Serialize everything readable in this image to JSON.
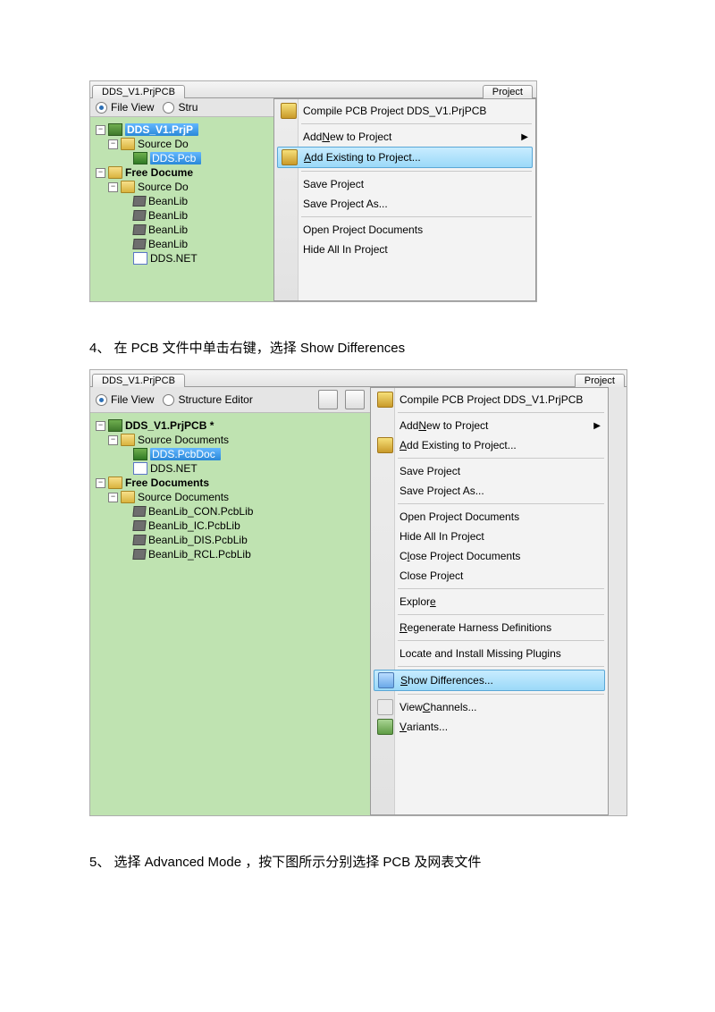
{
  "step4": "4、   在 PCB 文件中单击右键，选择 Show Differences",
  "step5": "5、   选择 Advanced Mode ，按下图所示分别选择 PCB 及网表文件",
  "shot1": {
    "tab_left": "DDS_V1.PrjPCB",
    "tab_right": "Project",
    "view_file": "File View",
    "view_struct": "Stru",
    "tree": {
      "proj": "DDS_V1.PrjP",
      "src1": "Source Do",
      "pcb": "DDS.Pcb",
      "free": "Free Docume",
      "src2": "Source Do",
      "libs": [
        "BeanLib",
        "BeanLib",
        "BeanLib",
        "BeanLib"
      ],
      "net": "DDS.NET"
    },
    "menu": {
      "compile": "Compile PCB Project DDS_V1.PrjPCB",
      "addnew_pre": "Add ",
      "addnew_u": "N",
      "addnew_post": "ew to Project",
      "addexist_u": "A",
      "addexist_post": "dd Existing to Project...",
      "save": "Save Project",
      "saveas": "Save Project As...",
      "open": "Open Project Documents",
      "hide": "Hide All In Project"
    }
  },
  "shot2": {
    "tab_left": "DDS_V1.PrjPCB",
    "tab_right": "Project",
    "view_file": "File View",
    "view_struct": "Structure Editor",
    "tree": {
      "proj": "DDS_V1.PrjPCB *",
      "src1": "Source Documents",
      "pcb": "DDS.PcbDoc",
      "net": "DDS.NET",
      "free": "Free Documents",
      "src2": "Source Documents",
      "libs": [
        "BeanLib_CON.PcbLib",
        "BeanLib_IC.PcbLib",
        "BeanLib_DIS.PcbLib",
        "BeanLib_RCL.PcbLib"
      ]
    },
    "menu": {
      "compile": "Compile PCB Project DDS_V1.PrjPCB",
      "addnew_pre": "Add ",
      "addnew_u": "N",
      "addnew_post": "ew to Project",
      "addexist_u": "A",
      "addexist_post": "dd Existing to Project...",
      "save": "Save Project",
      "saveas": "Save Project As...",
      "open": "Open Project Documents",
      "hide": "Hide All In Project",
      "close_pre": "C",
      "close_u": "l",
      "close_post": "ose Project Documents",
      "closeproj": "Close Project",
      "explore_pre": "Explor",
      "explore_u": "e",
      "regen_u": "R",
      "regen_post": "egenerate Harness Definitions",
      "locate": "Locate and Install Missing Plugins",
      "show_u": "S",
      "show_post": "how Differences...",
      "view_pre": "View ",
      "view_u": "C",
      "view_post": "hannels...",
      "var_u": "V",
      "var_post": "ariants..."
    }
  }
}
